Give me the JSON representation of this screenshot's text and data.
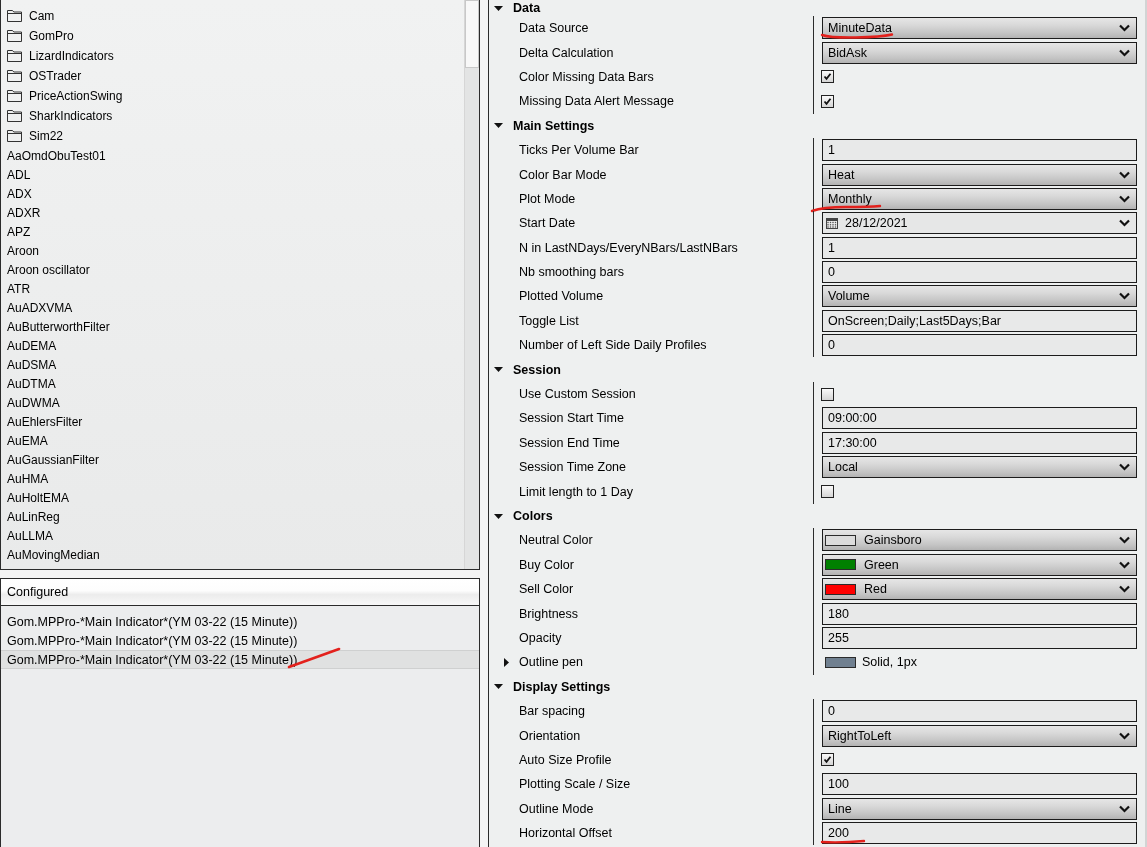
{
  "indicator_list": {
    "items": [
      {
        "kind": "folder",
        "label": "Cam"
      },
      {
        "kind": "folder",
        "label": "GomPro"
      },
      {
        "kind": "folder",
        "label": "LizardIndicators"
      },
      {
        "kind": "folder",
        "label": "OSTrader"
      },
      {
        "kind": "folder",
        "label": "PriceActionSwing"
      },
      {
        "kind": "folder",
        "label": "SharkIndicators"
      },
      {
        "kind": "folder",
        "label": "Sim22"
      },
      {
        "kind": "indicator",
        "label": "AaOmdObuTest01"
      },
      {
        "kind": "indicator",
        "label": "ADL"
      },
      {
        "kind": "indicator",
        "label": "ADX"
      },
      {
        "kind": "indicator",
        "label": "ADXR"
      },
      {
        "kind": "indicator",
        "label": "APZ"
      },
      {
        "kind": "indicator",
        "label": "Aroon"
      },
      {
        "kind": "indicator",
        "label": "Aroon oscillator"
      },
      {
        "kind": "indicator",
        "label": "ATR"
      },
      {
        "kind": "indicator",
        "label": "AuADXVMA"
      },
      {
        "kind": "indicator",
        "label": "AuButterworthFilter"
      },
      {
        "kind": "indicator",
        "label": "AuDEMA"
      },
      {
        "kind": "indicator",
        "label": "AuDSMA"
      },
      {
        "kind": "indicator",
        "label": "AuDTMA"
      },
      {
        "kind": "indicator",
        "label": "AuDWMA"
      },
      {
        "kind": "indicator",
        "label": "AuEhlersFilter"
      },
      {
        "kind": "indicator",
        "label": "AuEMA"
      },
      {
        "kind": "indicator",
        "label": "AuGaussianFilter"
      },
      {
        "kind": "indicator",
        "label": "AuHMA"
      },
      {
        "kind": "indicator",
        "label": "AuHoltEMA"
      },
      {
        "kind": "indicator",
        "label": "AuLinReg"
      },
      {
        "kind": "indicator",
        "label": "AuLLMA"
      },
      {
        "kind": "indicator",
        "label": "AuMovingMedian"
      }
    ]
  },
  "configured": {
    "title": "Configured",
    "items": [
      {
        "label": "Gom.MPPro-*Main Indicator*(YM 03-22 (15 Minute))",
        "selected": false,
        "marked": false
      },
      {
        "label": "Gom.MPPro-*Main Indicator*(YM 03-22 (15 Minute))",
        "selected": false,
        "marked": false
      },
      {
        "label": "Gom.MPPro-*Main Indicator*(YM 03-22 (15 Minute))",
        "selected": true,
        "marked": true
      }
    ]
  },
  "properties": {
    "sections": [
      {
        "title": "Data",
        "expanded": true,
        "properties": [
          {
            "kind": "dropdown",
            "label": "Data Source",
            "value": "MinuteData",
            "marked": true
          },
          {
            "kind": "dropdown",
            "label": "Delta Calculation",
            "value": "BidAsk",
            "marked": false
          },
          {
            "kind": "checkbox",
            "label": "Color Missing Data Bars",
            "checked": true,
            "marked": false
          },
          {
            "kind": "checkbox",
            "label": "Missing Data Alert Message",
            "checked": true,
            "marked": false
          }
        ]
      },
      {
        "title": "Main Settings",
        "expanded": true,
        "properties": [
          {
            "kind": "text",
            "label": "Ticks Per Volume Bar",
            "value": "1",
            "marked": false
          },
          {
            "kind": "dropdown",
            "label": "Color Bar Mode",
            "value": "Heat",
            "marked": false
          },
          {
            "kind": "dropdown",
            "label": "Plot Mode",
            "value": "Monthly",
            "marked": true
          },
          {
            "kind": "date",
            "label": "Start Date",
            "value": "28/12/2021",
            "marked": false
          },
          {
            "kind": "text",
            "label": "N in LastNDays/EveryNBars/LastNBars",
            "value": "1",
            "marked": false
          },
          {
            "kind": "text",
            "label": "Nb smoothing bars",
            "value": "0",
            "marked": false
          },
          {
            "kind": "dropdown",
            "label": "Plotted Volume",
            "value": "Volume",
            "marked": false
          },
          {
            "kind": "text",
            "label": "Toggle List",
            "value": "OnScreen;Daily;Last5Days;Bar",
            "marked": false
          },
          {
            "kind": "text",
            "label": "Number of Left Side Daily Profiles",
            "value": "0",
            "marked": false
          }
        ]
      },
      {
        "title": "Session",
        "expanded": true,
        "properties": [
          {
            "kind": "checkbox",
            "label": "Use Custom Session",
            "checked": false,
            "marked": false
          },
          {
            "kind": "text",
            "label": "Session Start Time",
            "value": "09:00:00",
            "marked": false
          },
          {
            "kind": "text",
            "label": "Session End Time",
            "value": "17:30:00",
            "marked": false
          },
          {
            "kind": "dropdown",
            "label": "Session Time Zone",
            "value": "Local",
            "marked": false
          },
          {
            "kind": "checkbox",
            "label": "Limit length to 1 Day",
            "checked": false,
            "marked": false
          }
        ]
      },
      {
        "title": "Colors",
        "expanded": true,
        "properties": [
          {
            "kind": "color",
            "label": "Neutral Color",
            "value": "Gainsboro",
            "color": "#dcdcdc",
            "marked": false
          },
          {
            "kind": "color",
            "label": "Buy Color",
            "value": "Green",
            "color": "#008000",
            "marked": false
          },
          {
            "kind": "color",
            "label": "Sell Color",
            "value": "Red",
            "color": "#ff0000",
            "marked": false
          },
          {
            "kind": "text",
            "label": "Brightness",
            "value": "180",
            "marked": false
          },
          {
            "kind": "text",
            "label": "Opacity",
            "value": "255",
            "marked": false
          },
          {
            "kind": "pen",
            "label": "Outline pen",
            "value": "Solid, 1px",
            "color": "#708090",
            "expanded": false,
            "marked": false
          }
        ]
      },
      {
        "title": "Display Settings",
        "expanded": true,
        "properties": [
          {
            "kind": "text",
            "label": "Bar spacing",
            "value": "0",
            "marked": false
          },
          {
            "kind": "dropdown",
            "label": "Orientation",
            "value": "RightToLeft",
            "marked": false
          },
          {
            "kind": "checkbox",
            "label": "Auto Size Profile",
            "checked": true,
            "marked": false
          },
          {
            "kind": "text",
            "label": "Plotting Scale / Size",
            "value": "100",
            "marked": false
          },
          {
            "kind": "dropdown",
            "label": "Outline Mode",
            "value": "Line",
            "marked": false
          },
          {
            "kind": "text",
            "label": "Horizontal Offset",
            "value": "200",
            "marked": true
          }
        ]
      }
    ]
  }
}
